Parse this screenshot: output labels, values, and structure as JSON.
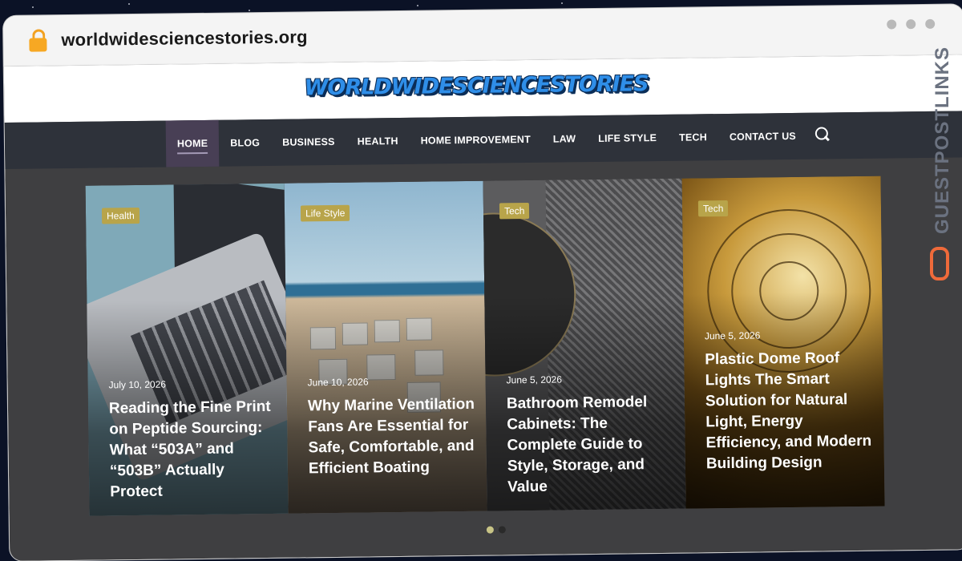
{
  "browser": {
    "url": "worldwidesciencestories.org"
  },
  "site": {
    "logo": "WORLDWIDESCIENCESTORIES",
    "nav": [
      {
        "label": "HOME",
        "active": true
      },
      {
        "label": "BLOG"
      },
      {
        "label": "BUSINESS"
      },
      {
        "label": "HEALTH"
      },
      {
        "label": "HOME IMPROVEMENT"
      },
      {
        "label": "LAW"
      },
      {
        "label": "LIFE STYLE"
      },
      {
        "label": "TECH"
      },
      {
        "label": "CONTACT US"
      }
    ]
  },
  "slides": [
    {
      "category": "Health",
      "date": "July 10, 2026",
      "title": "Reading the Fine Print on Peptide Sourcing: What “503A” and “503B” Actually Protect"
    },
    {
      "category": "Life Style",
      "date": "June 10, 2026",
      "title": "Why Marine Ventilation Fans Are Essential for Safe, Comfortable, and Efficient Boating"
    },
    {
      "category": "Tech",
      "date": "June 5, 2026",
      "title": "Bathroom Remodel Cabinets: The Complete Guide to Style, Storage, and Value"
    },
    {
      "category": "Tech",
      "date": "June 5, 2026",
      "title": "Plastic Dome Roof Lights The Smart Solution for Natural Light, Energy Efficiency, and Modern Building Design"
    }
  ],
  "pagination": {
    "active": 1,
    "count": 2
  },
  "watermark": "GUESTPOSTLINKS",
  "colors": {
    "badge": "#b8a44a",
    "nav_bg": "#2e323a",
    "active_nav": "#483f55",
    "watermark_icon": "#ef6a3a"
  }
}
